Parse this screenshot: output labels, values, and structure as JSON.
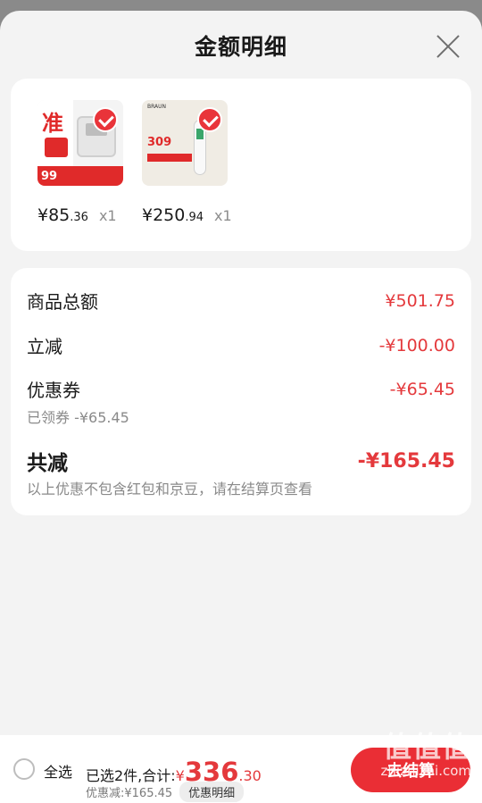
{
  "header": {
    "title": "金额明细"
  },
  "products": [
    {
      "price_int": "¥85",
      "price_dec": ".36",
      "qty": "x1",
      "thumb_text": "准",
      "thumb_badge": "99"
    },
    {
      "price_int": "¥250",
      "price_dec": ".94",
      "qty": "x1",
      "thumb_text": "309",
      "thumb_brand": "BRAUN"
    }
  ],
  "summary": {
    "subtotal_label": "商品总额",
    "subtotal_value": "¥501.75",
    "instant_label": "立减",
    "instant_value": "-¥100.00",
    "coupon_label": "优惠券",
    "coupon_value": "-¥65.45",
    "coupon_sub": "已领券 -¥65.45",
    "total_label": "共减",
    "total_value": "-¥165.45",
    "note": "以上优惠不包含红包和京豆，请在结算页查看"
  },
  "bottom": {
    "select_all": "全选",
    "selected_text": "已选2件,合计:",
    "total_symbol": "¥",
    "total_int": "336",
    "total_dec": ".30",
    "discount_text": "优惠减:¥165.45",
    "detail_button": "优惠明细",
    "checkout_button": "去结算"
  },
  "watermark": {
    "logo": "值值值",
    "url": "zhizhizhi.com"
  },
  "colors": {
    "accent": "#e4393c",
    "checkout": "#ea2e35",
    "background": "#f3f3f3"
  }
}
